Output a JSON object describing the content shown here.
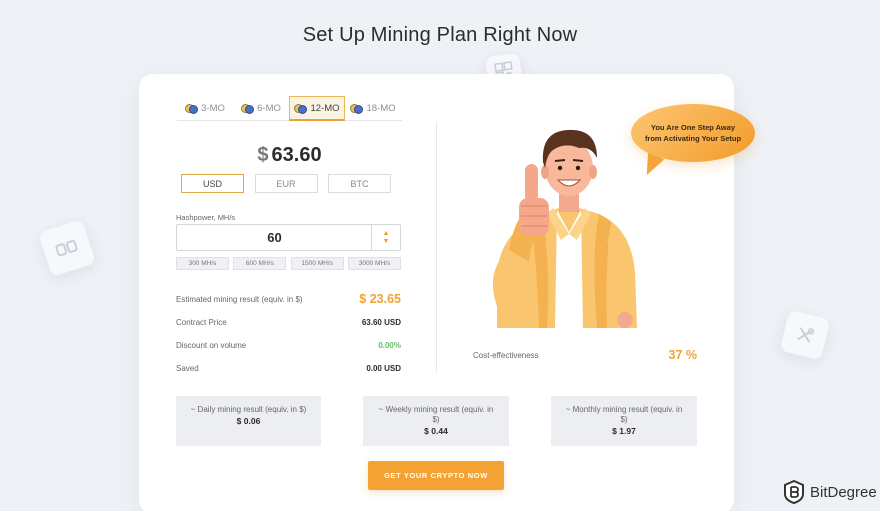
{
  "page": {
    "title": "Set Up Mining Plan Right Now"
  },
  "plan_tabs": [
    {
      "label": "3-MO",
      "active": false
    },
    {
      "label": "6-MO",
      "active": false
    },
    {
      "label": "12-MO",
      "active": true
    },
    {
      "label": "18-MO",
      "active": false
    }
  ],
  "price": {
    "symbol": "$",
    "amount": "63.60"
  },
  "currencies": [
    {
      "label": "USD",
      "active": true
    },
    {
      "label": "EUR",
      "active": false
    },
    {
      "label": "BTC",
      "active": false
    }
  ],
  "hashpower": {
    "label": "Hashpower, MH/s",
    "value": "60",
    "presets": [
      "300 MH/s",
      "600 MH/s",
      "1500 MH/s",
      "3000 MH/s"
    ]
  },
  "stats": {
    "estimated": {
      "label": "Estimated mining result (equiv. in $)",
      "value": "$ 23.65"
    },
    "contract": {
      "label": "Contract Price",
      "value": "63.60 USD"
    },
    "discount": {
      "label": "Discount on volume",
      "value": "0.00%"
    },
    "saved": {
      "label": "Saved",
      "value": "0.00 USD"
    }
  },
  "promo": {
    "bubble_text": "You Are One Step Away from Activating Your Setup"
  },
  "cost_effectiveness": {
    "label": "Cost-effectiveness",
    "value": "37 %"
  },
  "summary": {
    "daily": {
      "label": "~ Daily mining result (equiv. in $)",
      "amount": "$ 0.06"
    },
    "weekly": {
      "label": "~ Weekly mining result (equiv. in $)",
      "amount": "$ 0.44"
    },
    "monthly": {
      "label": "~ Monthly mining result (equiv. in $)",
      "amount": "$ 1.97"
    }
  },
  "cta": {
    "label": "GET YOUR CRYPTO NOW"
  },
  "brand": {
    "name": "BitDegree"
  },
  "colors": {
    "accent": "#f5a235",
    "positive": "#5fc06a",
    "background": "#eef1f6"
  }
}
